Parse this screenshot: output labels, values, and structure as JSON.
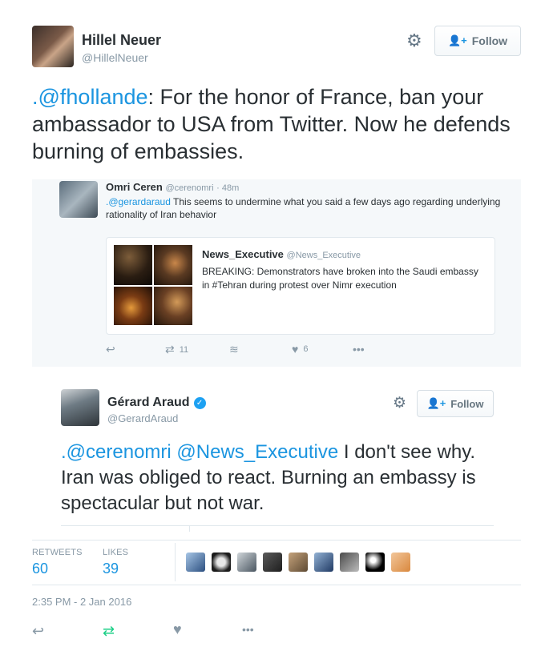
{
  "main_tweet": {
    "author_name": "Hillel Neuer",
    "author_handle": "@HillelNeuer",
    "follow_label": "Follow",
    "text_mention": ".@fhollande",
    "text_body": ": For the honor of France, ban your ambassador to USA from Twitter. Now he defends burning of embassies."
  },
  "quoted_tweet": {
    "author_name": "Omri Ceren",
    "author_handle": "@cerenomri",
    "time": "· 48m",
    "text_mention": ".@gerardaraud",
    "text_body": " This seems to undermine what you said a few days ago regarding underlying rationality of Iran behavior",
    "inner": {
      "author_name": "News_Executive",
      "author_handle": "@News_Executive",
      "text": "BREAKING: Demonstrators have broken into the Saudi embassy in #Tehran during protest over Nimr execution"
    },
    "actions": {
      "retweet_count": "11",
      "like_count": "6"
    }
  },
  "reply_tweet": {
    "author_name": "Gérard Araud",
    "author_handle": "@GerardAraud",
    "follow_label": "Follow",
    "mention1": ".@cerenomri",
    "mention2": "@News_Executive",
    "text_body": " I don't see why. Iran was obliged to react. Burning an embassy is spectacular but not war."
  },
  "stats": {
    "retweets_label": "RETWEETS",
    "retweets_value": "60",
    "likes_label": "LIKES",
    "likes_value": "39"
  },
  "timestamp": "2:35 PM - 2 Jan 2016",
  "colors": {
    "link": "#1b95e0",
    "verified": "#1da1f2",
    "retweet_active": "#19cf86"
  }
}
